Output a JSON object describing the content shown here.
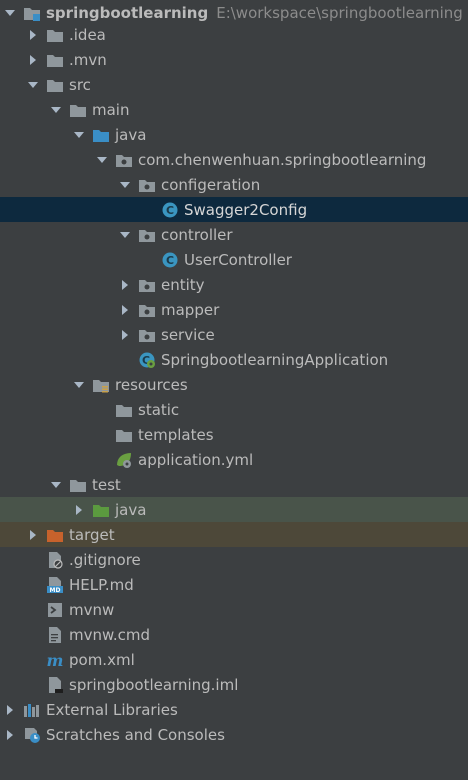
{
  "project_tree": {
    "root": {
      "label": "springbootlearning",
      "path": "E:\\workspace\\springbootlearning"
    },
    "idea": {
      "label": ".idea"
    },
    "mvn": {
      "label": ".mvn"
    },
    "src": {
      "label": "src"
    },
    "main": {
      "label": "main"
    },
    "main_java": {
      "label": "java"
    },
    "package": {
      "label": "com.chenwenhuan.springbootlearning"
    },
    "configeration": {
      "label": "configeration"
    },
    "swagger2config": {
      "label": "Swagger2Config"
    },
    "controller": {
      "label": "controller"
    },
    "usercontroller": {
      "label": "UserController"
    },
    "entity": {
      "label": "entity"
    },
    "mapper": {
      "label": "mapper"
    },
    "service": {
      "label": "service"
    },
    "application_class": {
      "label": "SpringbootlearningApplication"
    },
    "resources": {
      "label": "resources"
    },
    "static": {
      "label": "static"
    },
    "templates": {
      "label": "templates"
    },
    "application_yml": {
      "label": "application.yml"
    },
    "test": {
      "label": "test"
    },
    "test_java": {
      "label": "java"
    },
    "target": {
      "label": "target"
    },
    "gitignore": {
      "label": ".gitignore"
    },
    "help_md": {
      "label": "HELP.md"
    },
    "mvnw": {
      "label": "mvnw"
    },
    "mvnw_cmd": {
      "label": "mvnw.cmd"
    },
    "pom_xml": {
      "label": "pom.xml"
    },
    "iml": {
      "label": "springbootlearning.iml"
    },
    "external_libraries": {
      "label": "External Libraries"
    },
    "scratches": {
      "label": "Scratches and Consoles"
    }
  },
  "colors": {
    "background": "#3c3f41",
    "selection": "#0d293e",
    "test_row": "#49544a",
    "excluded_row": "#4d4839",
    "folder_grey": "#8f979c",
    "source_folder_blue": "#3a8ec6",
    "test_folder_green": "#5b9a3f",
    "excluded_folder_orange": "#c7622c",
    "class_icon": "#3a95c0",
    "spring_green": "#6a9f41"
  }
}
